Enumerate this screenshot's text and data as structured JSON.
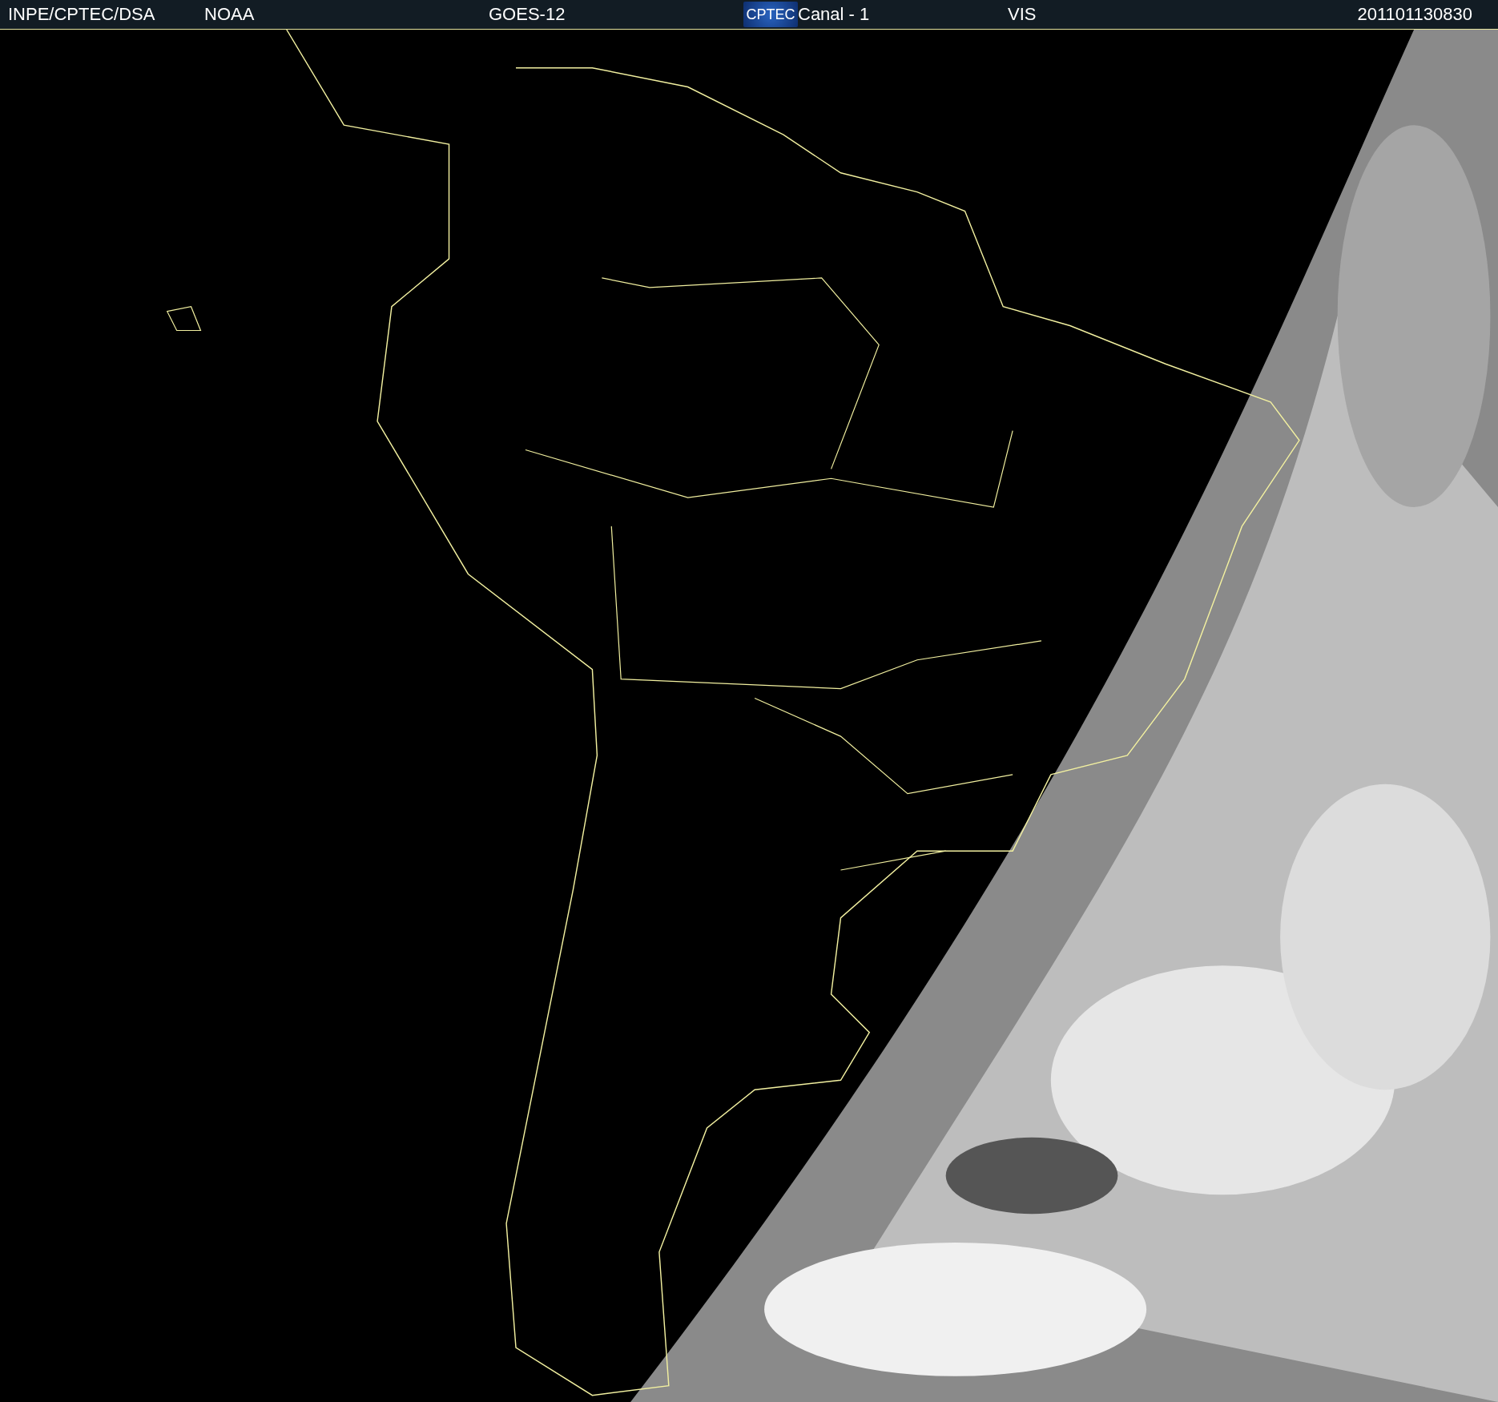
{
  "header": {
    "source": "INPE/CPTEC/DSA",
    "agency": "NOAA",
    "satellite": "GOES-12",
    "logo": "CPTEC",
    "channel": "Canal - 1",
    "band": "VIS",
    "timestamp": "201101130830"
  }
}
